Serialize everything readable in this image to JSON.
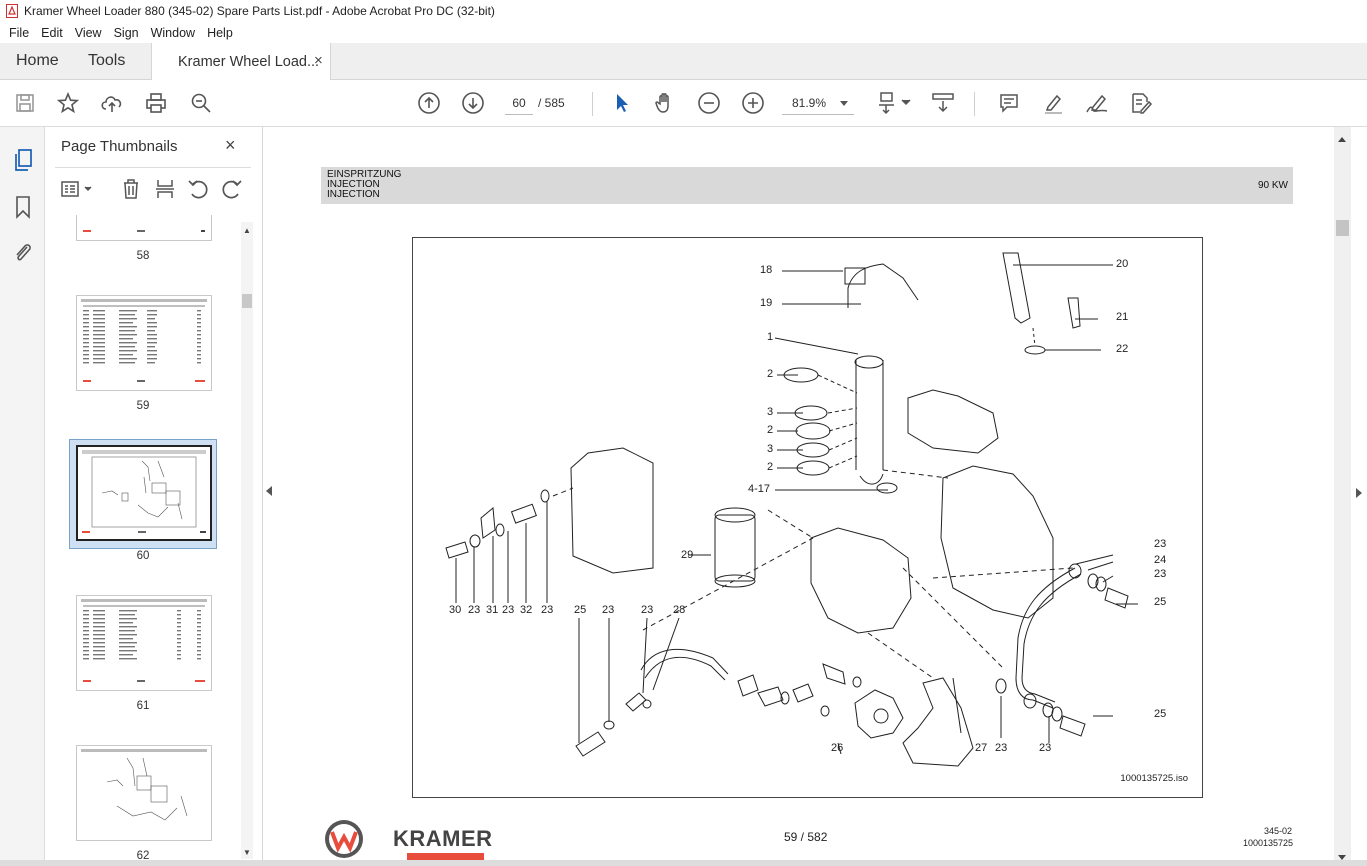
{
  "window": {
    "title": "Kramer Wheel Loader 880 (345-02) Spare Parts List.pdf - Adobe Acrobat Pro DC (32-bit)"
  },
  "menu": [
    "File",
    "Edit",
    "View",
    "Sign",
    "Window",
    "Help"
  ],
  "tabs": {
    "home": "Home",
    "tools": "Tools",
    "document": "Kramer Wheel Load...",
    "close": "×"
  },
  "toolbar": {
    "current_page": "60",
    "total_pages": "/ 585",
    "zoom": "81.9%",
    "icons": [
      "save-icon",
      "star-icon",
      "upload-icon",
      "print-icon",
      "search-zoom-icon",
      "page-up-icon",
      "page-down-icon",
      "select-cursor-icon",
      "hand-icon",
      "zoom-out-icon",
      "zoom-in-icon",
      "fit-page-icon",
      "scroll-mode-icon",
      "comment-icon",
      "highlight-icon",
      "sign-icon",
      "edit-pdf-icon"
    ]
  },
  "thumbnail_panel": {
    "title": "Page Thumbnails",
    "close": "×",
    "pages": [
      {
        "label": "58",
        "selected": false
      },
      {
        "label": "59",
        "selected": false
      },
      {
        "label": "60",
        "selected": true
      },
      {
        "label": "61",
        "selected": false
      },
      {
        "label": "62",
        "selected": false
      }
    ]
  },
  "page": {
    "header_lines": [
      "EINSPRITZUNG",
      "INJECTION",
      "INJECTION"
    ],
    "header_right": "90 KW",
    "diagram_id": "1000135725.iso",
    "callouts": [
      "18",
      "19",
      "1",
      "2",
      "3",
      "2",
      "3",
      "2",
      "4-17",
      "20",
      "21",
      "22",
      "29",
      "30",
      "23",
      "31",
      "23",
      "32",
      "23",
      "25",
      "23",
      "23",
      "28",
      "23",
      "24",
      "23",
      "25",
      "26",
      "27",
      "23",
      "23",
      "25"
    ],
    "footer_brand": "KRAMER",
    "footer_page": "59 / 582",
    "footer_code1": "345-02",
    "footer_code2": "1000135725"
  },
  "colors": {
    "accent_red": "#e74c3c",
    "header_gray": "#d9d9d9",
    "selected_thumb": "#cfe0f2"
  }
}
